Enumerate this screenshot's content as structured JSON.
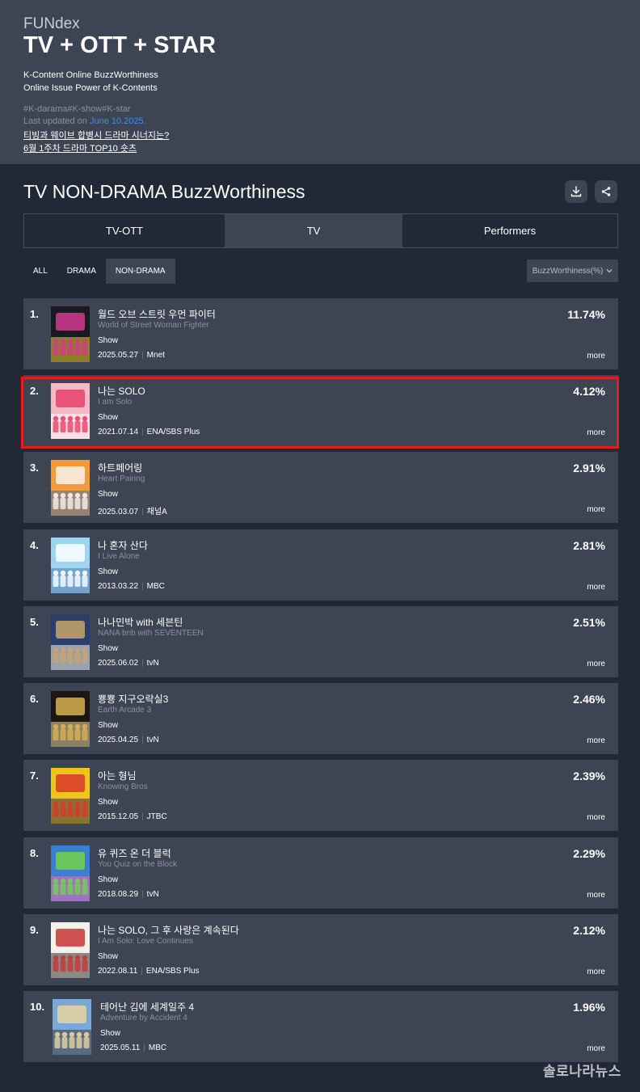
{
  "header": {
    "brand": "FUNdex",
    "headline": "TV + OTT + STAR",
    "subtitle_line1": "K-Content Online BuzzWorthiness",
    "subtitle_line2": "Online Issue Power of K-Contents",
    "tags": "#K-darama#K-show#K-star",
    "updated_prefix": "Last updated on ",
    "updated_date": "June 10.2025.",
    "link1": "티빙과 웨이브 합병시 드라마 시너지는?",
    "link2": "6월 1주차 드라마 TOP10 숏츠"
  },
  "section": {
    "title": "TV NON-DRAMA BuzzWorthiness",
    "download_icon": "download-icon",
    "share_icon": "share-icon"
  },
  "tabs": [
    {
      "label": "TV-OTT",
      "active": false
    },
    {
      "label": "TV",
      "active": true
    },
    {
      "label": "Performers",
      "active": false
    }
  ],
  "filters": [
    {
      "label": "ALL",
      "active": false
    },
    {
      "label": "DRAMA",
      "active": false
    },
    {
      "label": "NON-DRAMA",
      "active": true
    }
  ],
  "sort": {
    "label": "BuzzWorthiness(%)",
    "icon": "chevron-down-icon"
  },
  "items": [
    {
      "rank": "1.",
      "title_ko": "월드 오브 스트릿 우먼 파이터",
      "title_en": "World of Street Woman Fighter",
      "genre": "Show",
      "date": "2025.05.27",
      "channel": "Mnet",
      "percent": "11.74%",
      "more": "more"
    },
    {
      "rank": "2.",
      "title_ko": "나는 SOLO",
      "title_en": "I am Solo",
      "genre": "Show",
      "date": "2021.07.14",
      "channel": "ENA/SBS Plus",
      "percent": "4.12%",
      "more": "more"
    },
    {
      "rank": "3.",
      "title_ko": "하트페어링",
      "title_en": "Heart Pairing",
      "genre": "Show",
      "date": "2025.03.07",
      "channel": "채널A",
      "percent": "2.91%",
      "more": "more"
    },
    {
      "rank": "4.",
      "title_ko": "나 혼자 산다",
      "title_en": "I Live Alone",
      "genre": "Show",
      "date": "2013.03.22",
      "channel": "MBC",
      "percent": "2.81%",
      "more": "more"
    },
    {
      "rank": "5.",
      "title_ko": "나나민박 with 세븐틴",
      "title_en": "NANA bnb with SEVENTEEN",
      "genre": "Show",
      "date": "2025.06.02",
      "channel": "tvN",
      "percent": "2.51%",
      "more": "more"
    },
    {
      "rank": "6.",
      "title_ko": "뿅뿅 지구오락실3",
      "title_en": "Earth Arcade 3",
      "genre": "Show",
      "date": "2025.04.25",
      "channel": "tvN",
      "percent": "2.46%",
      "more": "more"
    },
    {
      "rank": "7.",
      "title_ko": "아는 형님",
      "title_en": "Knowing Bros",
      "genre": "Show",
      "date": "2015.12.05",
      "channel": "JTBC",
      "percent": "2.39%",
      "more": "more"
    },
    {
      "rank": "8.",
      "title_ko": "유 퀴즈 온 더 블럭",
      "title_en": "You Quiz on the Block",
      "genre": "Show",
      "date": "2018.08.29",
      "channel": "tvN",
      "percent": "2.29%",
      "more": "more"
    },
    {
      "rank": "9.",
      "title_ko": "나는 SOLO, 그 후 사랑은 계속된다",
      "title_en": "I Am Solo: Love Continues",
      "genre": "Show",
      "date": "2022.08.11",
      "channel": "ENA/SBS Plus",
      "percent": "2.12%",
      "more": "more"
    },
    {
      "rank": "10.",
      "title_ko": "테어난 김에 세계일주 4",
      "title_en": "Adventure by Accident 4",
      "genre": "Show",
      "date": "2025.05.11",
      "channel": "MBC",
      "percent": "1.96%",
      "more": "more"
    }
  ],
  "posters": [
    {
      "c1": "#1a1a22",
      "c2": "#d43a8f",
      "c3": "#f2d12b"
    },
    {
      "c1": "#f5b8c4",
      "c2": "#e8416a",
      "c3": "#ffffff",
      "text": "나는 솔로"
    },
    {
      "c1": "#f39a3b",
      "c2": "#f7f3ea",
      "c3": "#4a6fa5"
    },
    {
      "c1": "#9dd4f0",
      "c2": "#ffffff",
      "c3": "#4a7bb0",
      "text": "나 혼자 산다"
    },
    {
      "c1": "#2c3e6b",
      "c2": "#c9a46a",
      "c3": "#f4f1e8"
    },
    {
      "c1": "#1c1712",
      "c2": "#d9b24f",
      "c3": "#ead9a7"
    },
    {
      "c1": "#f0c419",
      "c2": "#d93a2b",
      "c3": "#2b3448"
    },
    {
      "c1": "#3b7fd1",
      "c2": "#73d14b",
      "c3": "#f06ab5"
    },
    {
      "c1": "#f4f1eb",
      "c2": "#c93535",
      "c3": "#333333"
    },
    {
      "c1": "#78a9d9",
      "c2": "#e8d4a0",
      "c3": "#3a3a3a"
    }
  ],
  "watermark": "솔로나라뉴스"
}
